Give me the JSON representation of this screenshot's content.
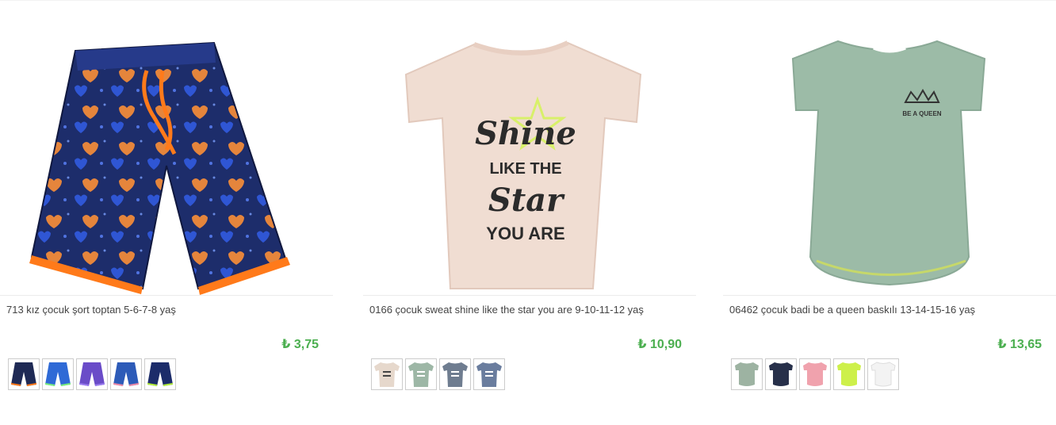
{
  "products": [
    {
      "title": "713 kız çocuk şort toptan 5-6-7-8 yaş",
      "price": "₺ 3,75",
      "image_icon": "shorts-icon",
      "thumbs": [
        {
          "icon": "shorts-icon",
          "color": "#1f2a55"
        },
        {
          "icon": "shorts-icon",
          "color": "#2f6ad6"
        },
        {
          "icon": "shorts-icon",
          "color": "#6a4cc8"
        },
        {
          "icon": "shorts-icon",
          "color": "#2d5bb8"
        },
        {
          "icon": "shorts-icon",
          "color": "#1c2c6a"
        }
      ]
    },
    {
      "title": "0166 çocuk sweat shine like the star you are 9-10-11-12 yaş",
      "price": "₺ 10,90",
      "image_icon": "tshirt-icon",
      "print_lines": [
        "Shine",
        "LIKE THE",
        "Star",
        "YOU ARE"
      ],
      "thumbs": [
        {
          "icon": "tshirt-icon",
          "color": "#e6d8cc"
        },
        {
          "icon": "tshirt-icon",
          "color": "#9db7a6"
        },
        {
          "icon": "tshirt-icon",
          "color": "#6f7d90"
        },
        {
          "icon": "tshirt-icon",
          "color": "#6a7d9e"
        }
      ]
    },
    {
      "title": "06462 çocuk badi be a queen baskılı 13-14-15-16 yaş",
      "price": "₺ 13,65",
      "image_icon": "long-tshirt-icon",
      "print_lines": [
        "BE A QUEEN"
      ],
      "thumbs": [
        {
          "icon": "long-tshirt-icon",
          "color": "#9db3a2"
        },
        {
          "icon": "long-tshirt-icon",
          "color": "#27304a"
        },
        {
          "icon": "long-tshirt-icon",
          "color": "#f0a2ad"
        },
        {
          "icon": "long-tshirt-icon",
          "color": "#cdf04a"
        },
        {
          "icon": "long-tshirt-icon",
          "color": "#f3f3f3"
        }
      ]
    }
  ],
  "colors": {
    "price": "#4caf50",
    "title": "#444444",
    "shorts_main": "#1d2d6b",
    "shorts_accent": "#f08a3a",
    "tshirt_main": "#f0ddd2",
    "long_tshirt_main": "#9cbba7"
  }
}
